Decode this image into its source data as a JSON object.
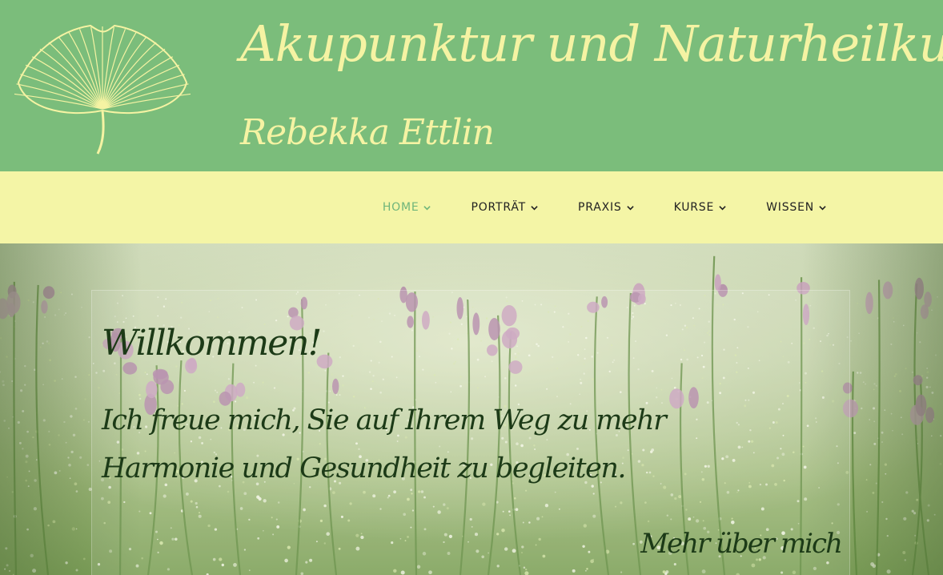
{
  "header": {
    "title": "Akupunktur und Naturheilkunde",
    "subtitle": "Rebekka Ettlin",
    "logo_icon": "ginkgo-leaf-icon",
    "background_color": "#7bbd7b",
    "text_color": "#f5f3a3"
  },
  "nav": {
    "background_color": "#f4f5a6",
    "active_color": "#6fb57a",
    "items": [
      {
        "label": "HOME",
        "active": true,
        "icon": "chevron-down-icon"
      },
      {
        "label": "PORTRÄT",
        "active": false,
        "icon": "chevron-down-icon"
      },
      {
        "label": "PRAXIS",
        "active": false,
        "icon": "chevron-down-icon"
      },
      {
        "label": "KURSE",
        "active": false,
        "icon": "chevron-down-icon"
      },
      {
        "label": "WISSEN",
        "active": false,
        "icon": "chevron-down-icon"
      }
    ]
  },
  "hero": {
    "background": "meadow-with-flowers",
    "title": "Willkommen!",
    "text": "Ich freue mich, Sie auf Ihrem Weg zu mehr Harmonie und Gesundheit zu begleiten.",
    "more_link": "Mehr über mich",
    "text_color": "#1c3a17"
  }
}
